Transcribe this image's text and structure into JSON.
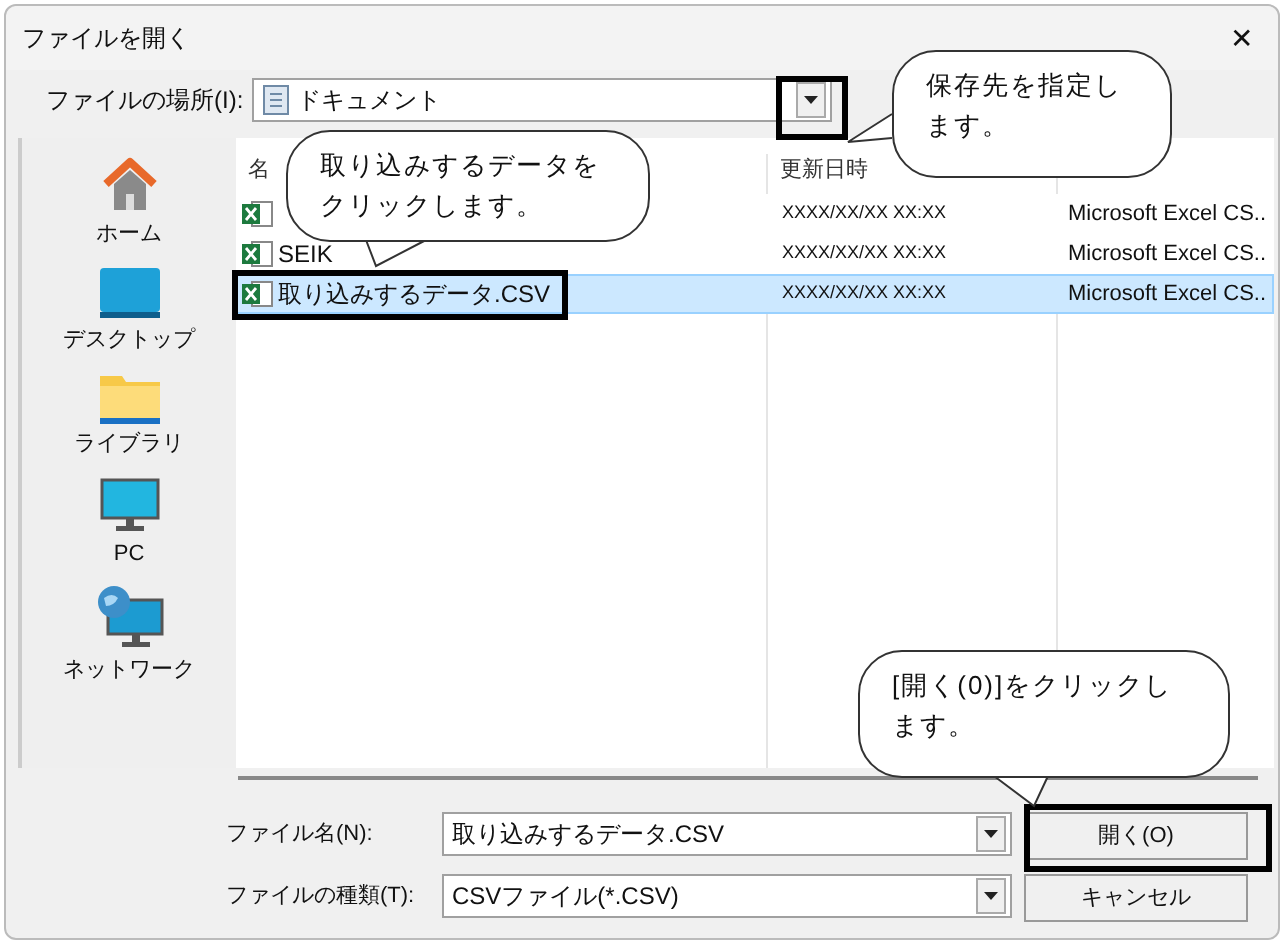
{
  "window": {
    "title": "ファイルを開く",
    "close": "✕"
  },
  "location": {
    "label": "ファイルの場所(I):",
    "value": "ドキュメント"
  },
  "sidebar": {
    "items": [
      {
        "kind": "home",
        "label": "ホーム"
      },
      {
        "kind": "desktop",
        "label": "デスクトップ"
      },
      {
        "kind": "library",
        "label": "ライブラリ"
      },
      {
        "kind": "pc",
        "label": "PC"
      },
      {
        "kind": "network",
        "label": "ネットワーク"
      }
    ]
  },
  "table": {
    "columns": [
      "名",
      "更新日時"
    ],
    "rows": [
      {
        "name": "",
        "date": "XXXX/XX/XX XX:XX",
        "type": "Microsoft Excel CS..",
        "selected": false
      },
      {
        "name": "SEIK",
        "date": "XXXX/XX/XX XX:XX",
        "type": "Microsoft Excel CS..",
        "selected": false
      },
      {
        "name": "取り込みするデータ.CSV",
        "date": "XXXX/XX/XX XX:XX",
        "type": "Microsoft Excel CS..",
        "selected": true
      }
    ]
  },
  "filename": {
    "label": "ファイル名(N):",
    "value": "取り込みするデータ.CSV"
  },
  "filetype": {
    "label": "ファイルの種類(T):",
    "value": "CSVファイル(*.CSV)"
  },
  "buttons": [
    "開く(O)",
    "キャンセル"
  ],
  "callouts": [
    {
      "text": "保存先を指定します。"
    },
    {
      "text": "取り込みするデータをクリックします。"
    },
    {
      "text": "[開く(0)]をクリックします。"
    }
  ]
}
